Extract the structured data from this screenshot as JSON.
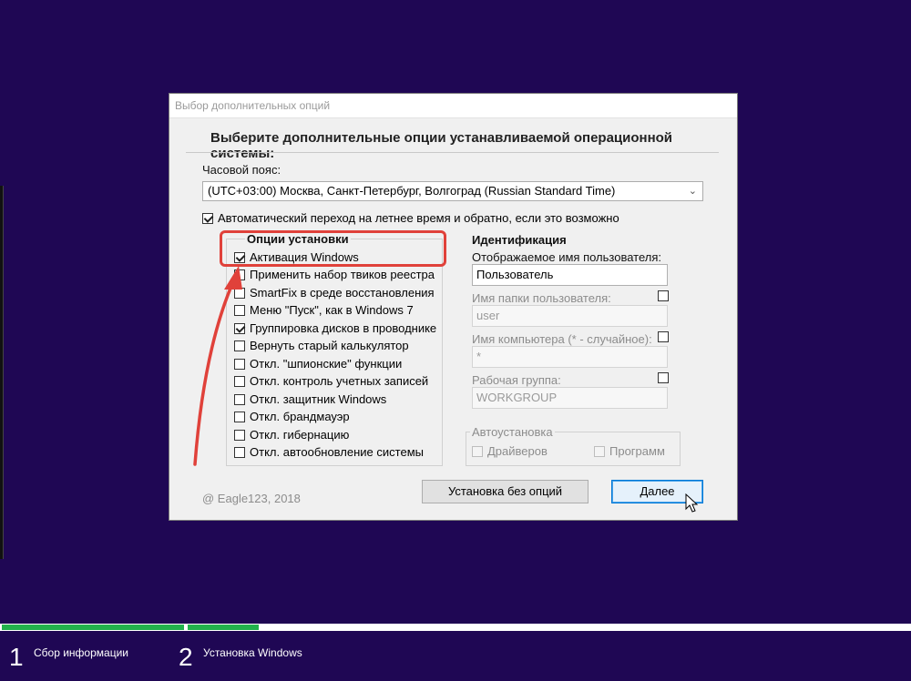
{
  "dialog": {
    "title": "Выбор дополнительных опций",
    "heading": "Выберите дополнительные опции устанавливаемой операционной системы:",
    "timezone_label": "Часовой пояс:",
    "timezone_value": "(UTC+03:00) Москва, Санкт-Петербург, Волгоград (Russian Standard Time)",
    "dst_label": "Автоматический переход на летнее время и обратно, если это возможно",
    "dst_checked": true,
    "options_group": {
      "title": "Опции установки",
      "items": [
        {
          "label": "Активация Windows",
          "checked": true
        },
        {
          "label": "Применить набор твиков реестра",
          "checked": false
        },
        {
          "label": "SmartFix в среде восстановления",
          "checked": false
        },
        {
          "label": "Меню \"Пуск\", как в Windows 7",
          "checked": false
        },
        {
          "label": "Группировка дисков в проводнике",
          "checked": true
        },
        {
          "label": "Вернуть старый калькулятор",
          "checked": false
        },
        {
          "label": "Откл. \"шпионские\" функции",
          "checked": false
        },
        {
          "label": "Откл. контроль учетных записей",
          "checked": false
        },
        {
          "label": "Откл. защитник Windows",
          "checked": false
        },
        {
          "label": "Откл. брандмауэр",
          "checked": false
        },
        {
          "label": "Откл. гибернацию",
          "checked": false
        },
        {
          "label": "Откл. автообновление системы",
          "checked": false
        }
      ]
    },
    "identity": {
      "title": "Идентификация",
      "display_name_label": "Отображаемое имя пользователя:",
      "display_name_value": "Пользователь",
      "folder_label": "Имя папки пользователя:",
      "folder_value": "user",
      "computer_label": "Имя компьютера (* - случайное):",
      "computer_value": "*",
      "workgroup_label": "Рабочая группа:",
      "workgroup_value": "WORKGROUP"
    },
    "autoinstall": {
      "title": "Автоустановка",
      "drivers": "Драйверов",
      "programs": "Программ"
    },
    "copyright": "@ Eagle123, 2018",
    "btn_no_options": "Установка без опций",
    "btn_next": "Далее"
  },
  "setup_steps": [
    {
      "number": "1",
      "label": "Сбор информации"
    },
    {
      "number": "2",
      "label": "Установка Windows"
    }
  ],
  "colors": {
    "background": "#1f0754",
    "progress": "#22b14c",
    "annotation": "#e0413a",
    "default_button": "#0078d7"
  }
}
